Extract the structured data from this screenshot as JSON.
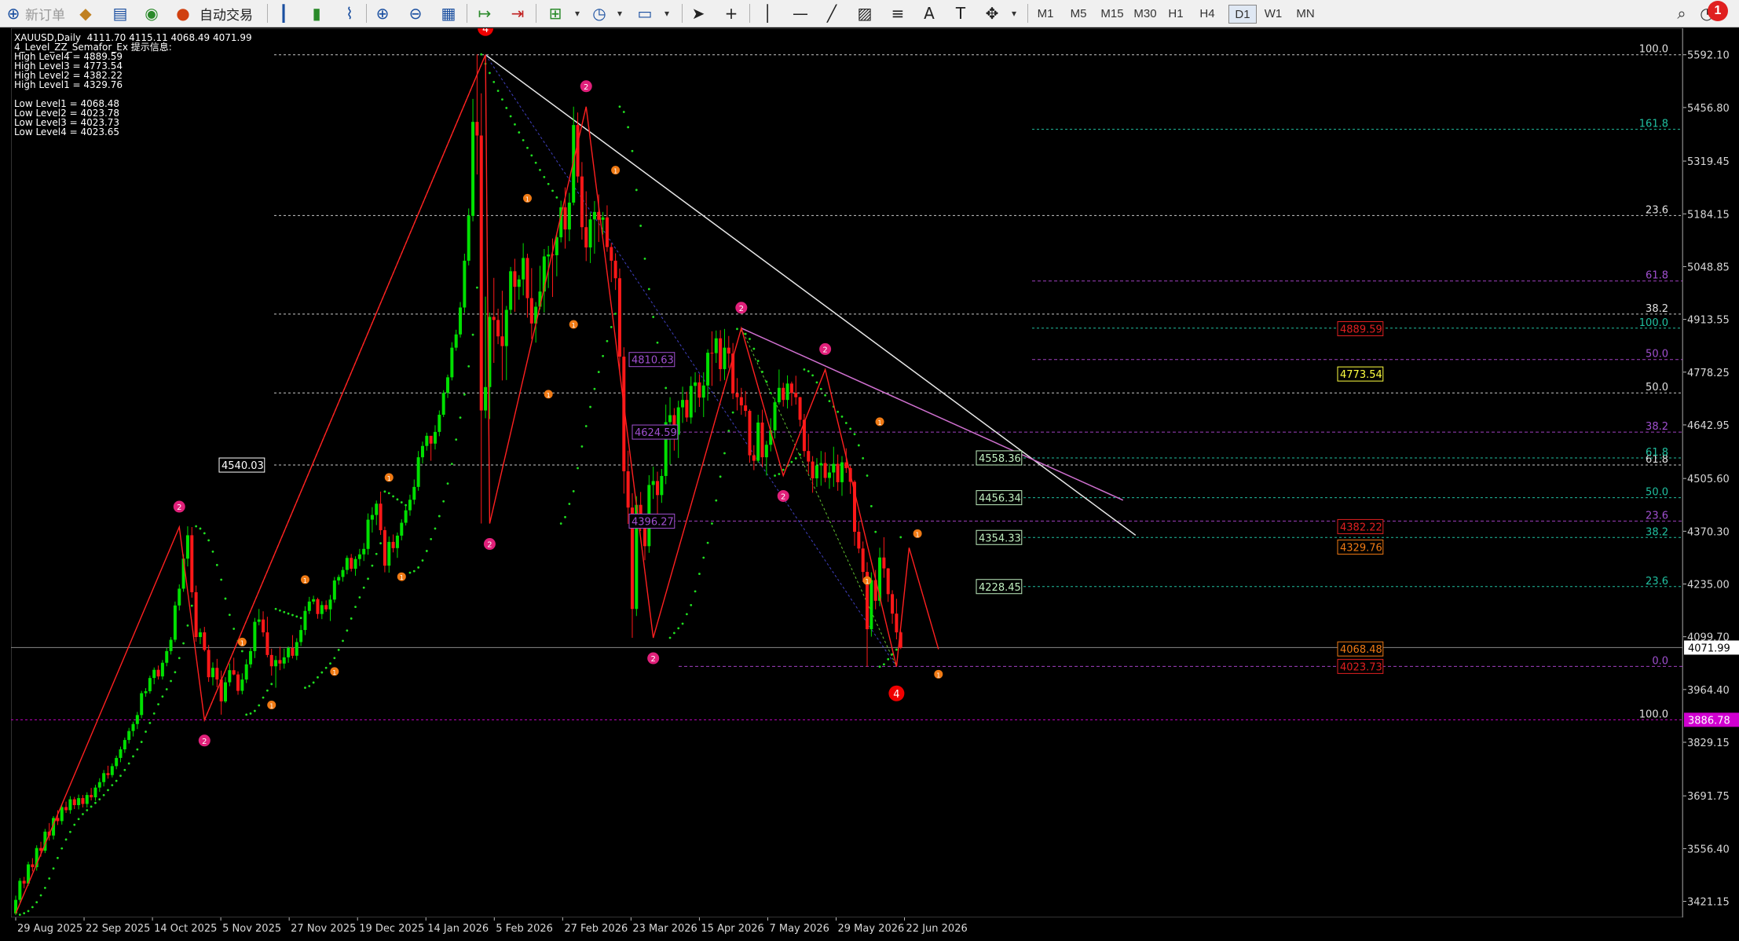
{
  "toolbar": {
    "new_order": "新订单",
    "auto_trade": "自动交易",
    "timeframes": [
      "M1",
      "M5",
      "M15",
      "M30",
      "H1",
      "H4",
      "D1",
      "W1",
      "MN"
    ],
    "alert_count": "1"
  },
  "info": {
    "header": "XAUUSD,Daily  4111.70 4115.11 4068.49 4071.99",
    "indicator": "4_Level_ZZ_Semafor_Ex 提示信息:",
    "high_levels": [
      "High Level4 = 4889.59",
      "High Level3 = 4773.54",
      "High Level2 = 4382.22",
      "High Level1 = 4329.76"
    ],
    "low_levels": [
      "Low Level1 = 4068.48",
      "Low Level2 = 4023.78",
      "Low Level3 = 4023.73",
      "Low Level4 = 4023.65"
    ]
  },
  "price_axis": {
    "ticks": [
      "5592.10",
      "5456.80",
      "5319.45",
      "5184.15",
      "5048.85",
      "4913.55",
      "4778.25",
      "4642.95",
      "4505.60",
      "4370.30",
      "4235.00",
      "4099.70",
      "3964.40",
      "3829.15",
      "3691.75",
      "3556.40",
      "3421.15"
    ],
    "current_price": "4071.99",
    "magenta_label": "3886.78"
  },
  "time_axis": [
    "29 Aug 2025",
    "22 Sep 2025",
    "14 Oct 2025",
    "5 Nov 2025",
    "27 Nov 2025",
    "19 Dec 2025",
    "14 Jan 2026",
    "5 Feb 2026",
    "27 Feb 2026",
    "23 Mar 2026",
    "15 Apr 2026",
    "7 May 2026",
    "29 May 2026",
    "22 Jun 2026"
  ],
  "level_labels": {
    "left_box": "4540.03",
    "purple": [
      "4810.63",
      "4624.59",
      "4396.27"
    ],
    "green": [
      "4558.36",
      "4456.34",
      "4354.33",
      "4228.45"
    ],
    "right_red": [
      "4889.59",
      "4382.22",
      "4329.76",
      "4068.48",
      "4023.73"
    ],
    "right_yellow": "4773.54"
  },
  "fib_labels": {
    "white_big": [
      "100.0",
      "0.0",
      "23.6",
      "38.2",
      "50.0",
      "61.8",
      "100.0"
    ],
    "teal": [
      "161.8",
      "100.0",
      "61.8",
      "50.0",
      "38.2",
      "23.6"
    ],
    "purple": [
      "61.8",
      "50.0",
      "38.2",
      "23.6",
      "0.0"
    ]
  },
  "semafor_labels": [
    "4",
    "2",
    "1"
  ],
  "chart_data": {
    "type": "candlestick",
    "symbol": "XAUUSD",
    "timeframe": "Daily",
    "ohlc_last": {
      "open": 4111.7,
      "high": 4115.11,
      "low": 4068.49,
      "close": 4071.99
    },
    "ylim": [
      3380,
      5660
    ],
    "candles": [
      [
        3390,
        3436,
        3386,
        3425
      ],
      [
        3425,
        3481,
        3419,
        3474
      ],
      [
        3474,
        3484,
        3455,
        3467
      ],
      [
        3467,
        3523,
        3461,
        3516
      ],
      [
        3516,
        3532,
        3498,
        3509
      ],
      [
        3509,
        3565,
        3500,
        3558
      ],
      [
        3558,
        3574,
        3536,
        3551
      ],
      [
        3551,
        3607,
        3545,
        3600
      ],
      [
        3600,
        3622,
        3577,
        3590
      ],
      [
        3590,
        3640,
        3580,
        3635
      ],
      [
        3635,
        3655,
        3617,
        3627
      ],
      [
        3627,
        3671,
        3618,
        3663
      ],
      [
        3663,
        3677,
        3648,
        3655
      ],
      [
        3655,
        3691,
        3646,
        3683
      ],
      [
        3683,
        3689,
        3658,
        3668
      ],
      [
        3668,
        3695,
        3657,
        3686
      ],
      [
        3686,
        3694,
        3662,
        3671
      ],
      [
        3671,
        3701,
        3662,
        3694
      ],
      [
        3694,
        3712,
        3680,
        3688
      ],
      [
        3688,
        3720,
        3679,
        3713
      ],
      [
        3713,
        3737,
        3702,
        3727
      ],
      [
        3727,
        3758,
        3716,
        3750
      ],
      [
        3750,
        3769,
        3736,
        3745
      ],
      [
        3745,
        3775,
        3739,
        3768
      ],
      [
        3768,
        3795,
        3760,
        3789
      ],
      [
        3789,
        3818,
        3778,
        3811
      ],
      [
        3811,
        3841,
        3802,
        3835
      ],
      [
        3835,
        3866,
        3826,
        3858
      ],
      [
        3858,
        3882,
        3844,
        3876
      ],
      [
        3876,
        3907,
        3863,
        3899
      ],
      [
        3899,
        3961,
        3891,
        3955
      ],
      [
        3955,
        3968,
        3946,
        3960
      ],
      [
        3960,
        4000,
        3954,
        3994
      ],
      [
        3994,
        4021,
        3978,
        4015
      ],
      [
        4015,
        4026,
        3990,
        3998
      ],
      [
        3998,
        4040,
        3990,
        4033
      ],
      [
        4033,
        4071,
        4024,
        4063
      ],
      [
        4063,
        4099,
        4054,
        4092
      ],
      [
        4092,
        4190,
        4086,
        4180
      ],
      [
        4180,
        4234,
        4167,
        4223
      ],
      [
        4223,
        4311,
        4215,
        4300
      ],
      [
        4300,
        4383,
        4280,
        4360
      ],
      [
        4360,
        4381,
        4200,
        4214
      ],
      [
        4214,
        4231,
        4087,
        4099
      ],
      [
        4099,
        4121,
        4081,
        4111
      ],
      [
        4111,
        4125,
        4062,
        4066
      ],
      [
        4066,
        4079,
        3984,
        3996
      ],
      [
        3996,
        4034,
        3975,
        4020
      ],
      [
        4020,
        4043,
        3970,
        3990
      ],
      [
        3990,
        4013,
        3900,
        3934
      ],
      [
        3934,
        3996,
        3930,
        3983
      ],
      [
        3983,
        4031,
        3973,
        4014
      ],
      [
        4014,
        4046,
        4001,
        4003
      ],
      [
        4003,
        4011,
        3951,
        3961
      ],
      [
        3961,
        4006,
        3952,
        3990
      ],
      [
        3990,
        4042,
        3981,
        4029
      ],
      [
        4029,
        4071,
        4020,
        4063
      ],
      [
        4063,
        4148,
        4045,
        4138
      ],
      [
        4138,
        4171,
        4129,
        4144
      ],
      [
        4144,
        4165,
        4100,
        4111
      ],
      [
        4111,
        4151,
        4047,
        4053
      ],
      [
        4053,
        4069,
        4000,
        4024
      ],
      [
        4024,
        4051,
        3969,
        4040
      ],
      [
        4040,
        4074,
        4014,
        4031
      ],
      [
        4031,
        4069,
        4018,
        4047
      ],
      [
        4047,
        4075,
        4033,
        4071
      ],
      [
        4071,
        4104,
        4044,
        4051
      ],
      [
        4051,
        4096,
        4040,
        4086
      ],
      [
        4086,
        4130,
        4076,
        4117
      ],
      [
        4117,
        4178,
        4104,
        4166
      ],
      [
        4166,
        4202,
        4158,
        4190
      ],
      [
        4190,
        4205,
        4183,
        4196
      ],
      [
        4196,
        4200,
        4146,
        4158
      ],
      [
        4158,
        4191,
        4145,
        4181
      ],
      [
        4181,
        4193,
        4164,
        4170
      ],
      [
        4170,
        4207,
        4140,
        4195
      ],
      [
        4195,
        4253,
        4187,
        4244
      ],
      [
        4244,
        4259,
        4233,
        4253
      ],
      [
        4253,
        4279,
        4241,
        4271
      ],
      [
        4271,
        4308,
        4260,
        4302
      ],
      [
        4302,
        4312,
        4267,
        4274
      ],
      [
        4274,
        4306,
        4256,
        4299
      ],
      [
        4299,
        4325,
        4281,
        4311
      ],
      [
        4311,
        4340,
        4294,
        4325
      ],
      [
        4325,
        4416,
        4310,
        4400
      ],
      [
        4400,
        4432,
        4367,
        4412
      ],
      [
        4412,
        4449,
        4386,
        4441
      ],
      [
        4441,
        4472,
        4361,
        4373
      ],
      [
        4373,
        4382,
        4265,
        4282
      ],
      [
        4282,
        4357,
        4264,
        4343
      ],
      [
        4343,
        4362,
        4316,
        4327
      ],
      [
        4327,
        4367,
        4302,
        4359
      ],
      [
        4359,
        4401,
        4347,
        4392
      ],
      [
        4392,
        4437,
        4385,
        4424
      ],
      [
        4424,
        4464,
        4410,
        4451
      ],
      [
        4451,
        4503,
        4439,
        4484
      ],
      [
        4484,
        4576,
        4474,
        4560
      ],
      [
        4560,
        4600,
        4544,
        4589
      ],
      [
        4589,
        4623,
        4577,
        4615
      ],
      [
        4615,
        4610,
        4551,
        4595
      ],
      [
        4595,
        4642,
        4580,
        4625
      ],
      [
        4625,
        4680,
        4614,
        4669
      ],
      [
        4669,
        4732,
        4663,
        4725
      ],
      [
        4725,
        4772,
        4712,
        4765
      ],
      [
        4765,
        4855,
        4757,
        4841
      ],
      [
        4841,
        4887,
        4833,
        4875
      ],
      [
        4875,
        4958,
        4867,
        4944
      ],
      [
        4944,
        5082,
        4930,
        5064
      ],
      [
        5064,
        5198,
        5052,
        5179
      ],
      [
        5179,
        5479,
        5165,
        5420
      ],
      [
        5420,
        5593,
        5285,
        5385
      ],
      [
        5385,
        5493,
        4390,
        4680
      ],
      [
        4680,
        4972,
        4660,
        4740
      ],
      [
        4740,
        4931,
        4658,
        4920
      ],
      [
        4920,
        5020,
        4802,
        4912
      ],
      [
        4912,
        4941,
        4850,
        4870
      ],
      [
        4870,
        4987,
        4757,
        4845
      ],
      [
        4845,
        4948,
        4758,
        4938
      ],
      [
        4938,
        5048,
        4927,
        5037
      ],
      [
        5037,
        5069,
        4933,
        4997
      ],
      [
        4997,
        5027,
        4964,
        5016
      ],
      [
        5016,
        5109,
        4975,
        5071
      ],
      [
        5071,
        5082,
        4918,
        4968
      ],
      [
        4968,
        5045,
        4863,
        4903
      ],
      [
        4903,
        4958,
        4854,
        4946
      ],
      [
        4946,
        5051,
        4939,
        4985
      ],
      [
        4985,
        5094,
        4931,
        5075
      ],
      [
        5075,
        5102,
        4994,
        5080
      ],
      [
        5080,
        5121,
        4971,
        5078
      ],
      [
        5078,
        5135,
        5024,
        5124
      ],
      [
        5124,
        5218,
        5111,
        5201
      ],
      [
        5201,
        5252,
        5095,
        5144
      ],
      [
        5144,
        5238,
        5114,
        5213
      ],
      [
        5213,
        5459,
        5206,
        5412
      ],
      [
        5412,
        5444,
        5264,
        5280
      ],
      [
        5280,
        5317,
        5118,
        5150
      ],
      [
        5150,
        5242,
        5063,
        5098
      ],
      [
        5098,
        5188,
        5058,
        5170
      ],
      [
        5170,
        5217,
        5082,
        5189
      ],
      [
        5189,
        5234,
        5112,
        5169
      ],
      [
        5169,
        5189,
        5131,
        5175
      ],
      [
        5175,
        5206,
        5087,
        5099
      ],
      [
        5099,
        5109,
        5009,
        5064
      ],
      [
        5064,
        5083,
        4989,
        5019
      ],
      [
        5019,
        5044,
        4783,
        4818
      ],
      [
        4818,
        4842,
        4467,
        4524
      ],
      [
        4524,
        4577,
        4389,
        4431
      ],
      [
        4431,
        4468,
        4097,
        4171
      ],
      [
        4171,
        4460,
        4153,
        4438
      ],
      [
        4438,
        4471,
        4371,
        4393
      ],
      [
        4393,
        4408,
        4296,
        4332
      ],
      [
        4332,
        4514,
        4315,
        4489
      ],
      [
        4489,
        4536,
        4453,
        4499
      ],
      [
        4499,
        4523,
        4407,
        4463
      ],
      [
        4463,
        4530,
        4443,
        4512
      ],
      [
        4512,
        4695,
        4491,
        4650
      ],
      [
        4650,
        4714,
        4541,
        4668
      ],
      [
        4668,
        4686,
        4577,
        4618
      ],
      [
        4618,
        4705,
        4558,
        4688
      ],
      [
        4688,
        4741,
        4648,
        4707
      ],
      [
        4707,
        4728,
        4651,
        4662
      ],
      [
        4662,
        4767,
        4646,
        4743
      ],
      [
        4743,
        4778,
        4675,
        4752
      ],
      [
        4752,
        4773,
        4689,
        4713
      ],
      [
        4713,
        4778,
        4663,
        4744
      ],
      [
        4744,
        4837,
        4705,
        4828
      ],
      [
        4828,
        4883,
        4743,
        4827
      ],
      [
        4827,
        4885,
        4802,
        4865
      ],
      [
        4865,
        4886,
        4755,
        4786
      ],
      [
        4786,
        4889,
        4758,
        4841
      ],
      [
        4841,
        4871,
        4789,
        4826
      ],
      [
        4826,
        4853,
        4709,
        4724
      ],
      [
        4724,
        4763,
        4680,
        4714
      ],
      [
        4714,
        4738,
        4669,
        4693
      ],
      [
        4693,
        4730,
        4664,
        4679
      ],
      [
        4679,
        4683,
        4546,
        4565
      ],
      [
        4565,
        4591,
        4527,
        4551
      ],
      [
        4551,
        4669,
        4546,
        4649
      ],
      [
        4649,
        4682,
        4535,
        4560
      ],
      [
        4560,
        4602,
        4513,
        4592
      ],
      [
        4592,
        4660,
        4575,
        4629
      ],
      [
        4629,
        4712,
        4608,
        4701
      ],
      [
        4701,
        4785,
        4695,
        4738
      ],
      [
        4738,
        4751,
        4690,
        4707
      ],
      [
        4707,
        4770,
        4685,
        4749
      ],
      [
        4749,
        4754,
        4692,
        4725
      ],
      [
        4725,
        4769,
        4695,
        4714
      ],
      [
        4714,
        4715,
        4639,
        4656
      ],
      [
        4656,
        4671,
        4561,
        4576
      ],
      [
        4576,
        4620,
        4517,
        4549
      ],
      [
        4549,
        4563,
        4469,
        4506
      ],
      [
        4506,
        4558,
        4484,
        4539
      ],
      [
        4539,
        4576,
        4487,
        4545
      ],
      [
        4545,
        4573,
        4496,
        4507
      ],
      [
        4507,
        4543,
        4479,
        4521
      ],
      [
        4521,
        4587,
        4484,
        4543
      ],
      [
        4543,
        4567,
        4474,
        4496
      ],
      [
        4496,
        4563,
        4461,
        4547
      ],
      [
        4547,
        4583,
        4520,
        4532
      ],
      [
        4532,
        4538,
        4466,
        4497
      ],
      [
        4497,
        4501,
        4333,
        4369
      ],
      [
        4369,
        4396,
        4314,
        4326
      ],
      [
        4326,
        4344,
        4240,
        4266
      ],
      [
        4266,
        4291,
        4023,
        4119
      ],
      [
        4119,
        4265,
        4100,
        4245
      ],
      [
        4245,
        4271,
        4170,
        4192
      ],
      [
        4192,
        4328,
        4178,
        4303
      ],
      [
        4303,
        4355,
        4251,
        4275
      ],
      [
        4275,
        4276,
        4189,
        4209
      ],
      [
        4209,
        4219,
        4133,
        4159
      ],
      [
        4159,
        4197,
        4093,
        4111
      ],
      [
        4111,
        4115,
        4068,
        4072
      ]
    ]
  }
}
